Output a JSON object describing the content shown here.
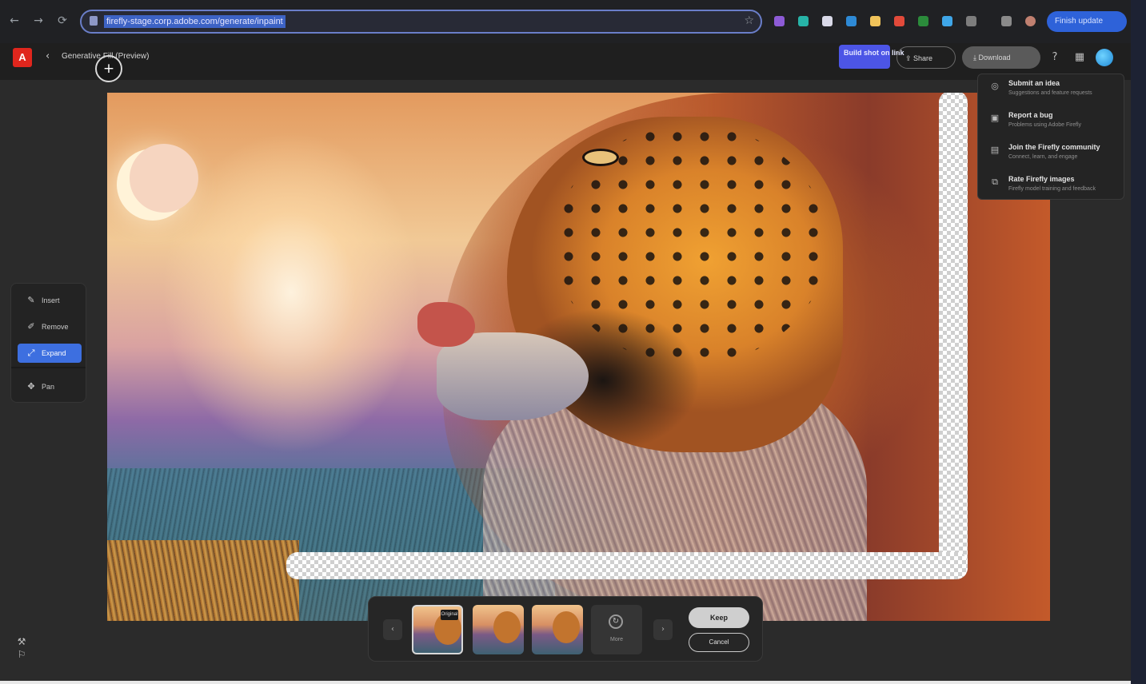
{
  "browser": {
    "url": "firefly-stage.corp.adobe.com/generate/inpaint",
    "update_button": "Finish update"
  },
  "header": {
    "logo": "A",
    "title": "Generative Fill (Preview)",
    "build_button": "Build shot on link",
    "share_button": "Share",
    "download_button": "Download"
  },
  "tools": [
    {
      "icon": "insert-icon",
      "label": "Insert"
    },
    {
      "icon": "remove-icon",
      "label": "Remove"
    },
    {
      "icon": "expand-icon",
      "label": "Expand",
      "active": true
    },
    {
      "icon": "pan-icon",
      "label": "Pan"
    }
  ],
  "help_menu": [
    {
      "icon": "lightbulb-icon",
      "title": "Submit an idea",
      "subtitle": "Suggestions and feature requests"
    },
    {
      "icon": "bug-icon",
      "title": "Report a bug",
      "subtitle": "Problems using Adobe Firefly"
    },
    {
      "icon": "community-icon",
      "title": "Join the Firefly community",
      "subtitle": "Connect, learn, and engage"
    },
    {
      "icon": "rate-icon",
      "title": "Rate Firefly images",
      "subtitle": "Firefly model training and feedback"
    }
  ],
  "variations": {
    "badge": "Original",
    "more_label": "More",
    "keep_button": "Keep",
    "cancel_button": "Cancel"
  },
  "colors": {
    "accent": "#3d6fe0",
    "build_button": "#4c55e6",
    "adobe_red": "#e0261d"
  }
}
